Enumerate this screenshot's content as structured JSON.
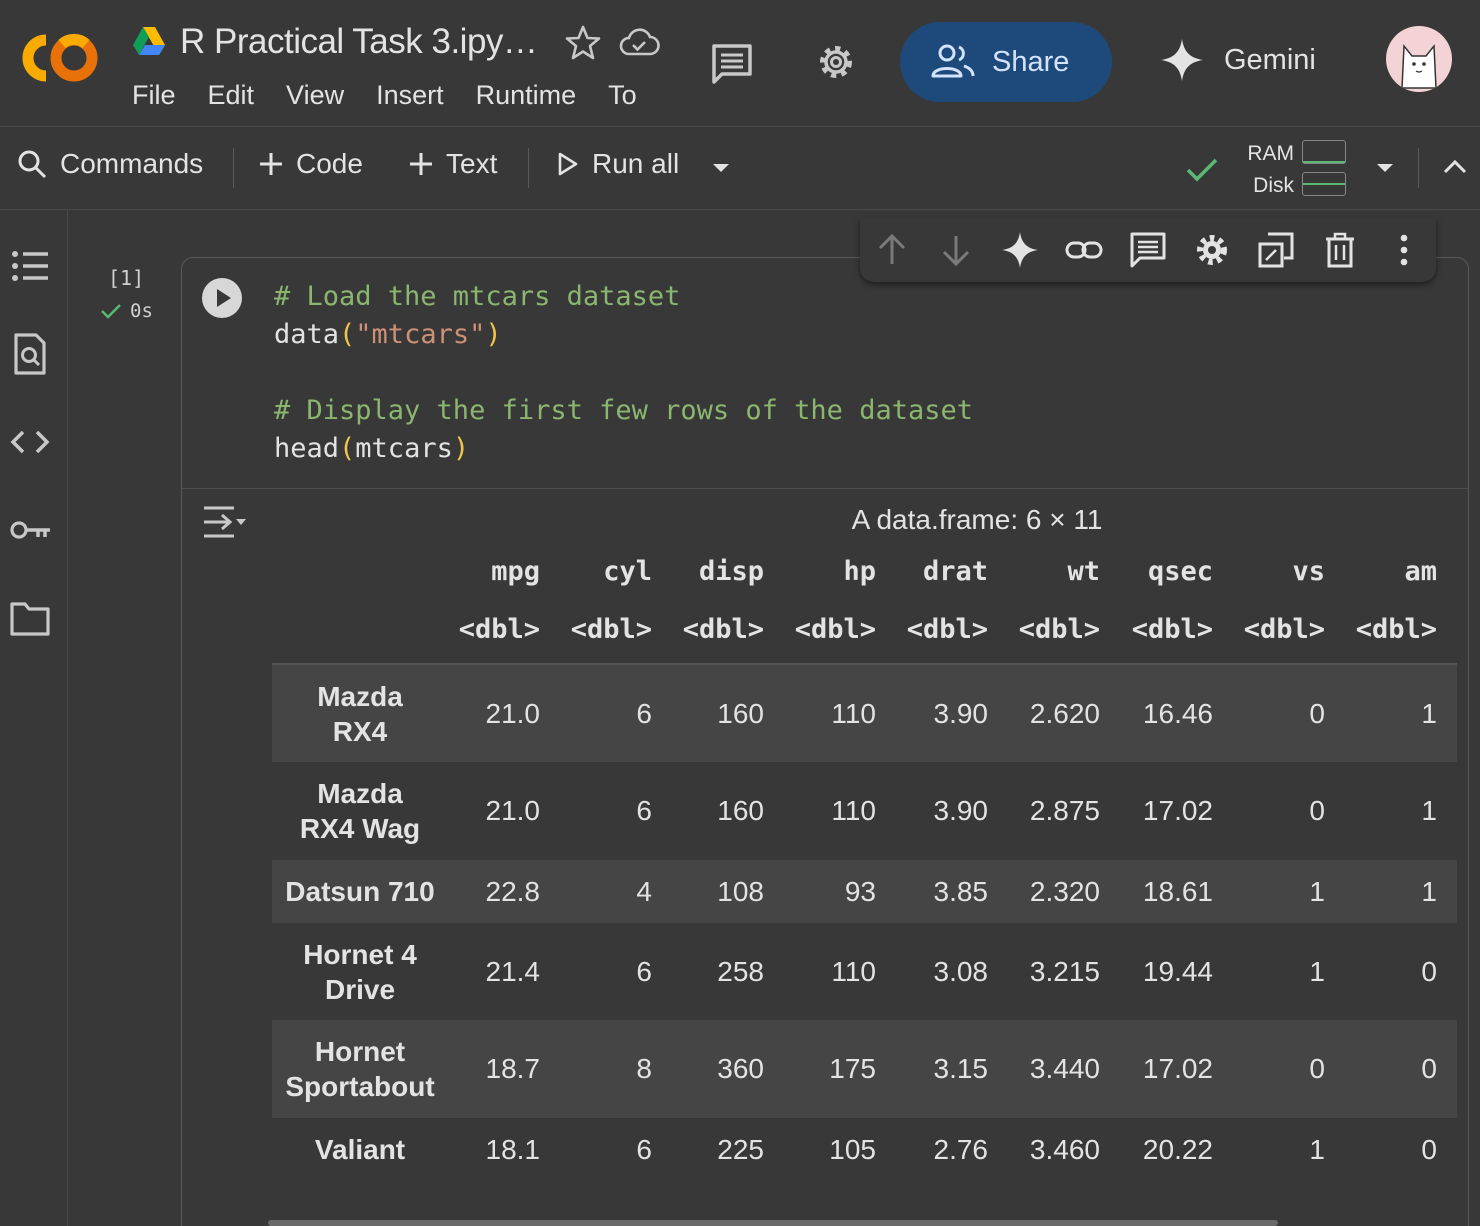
{
  "app": {
    "notebook_title": "R Practical Task 3.ipy…",
    "menu": [
      "File",
      "Edit",
      "View",
      "Insert",
      "Runtime",
      "To"
    ],
    "share_label": "Share",
    "gemini_label": "Gemini"
  },
  "toolbar": {
    "commands_label": "Commands",
    "code_label": "Code",
    "text_label": "Text",
    "run_all_label": "Run all",
    "ram_label": "RAM",
    "disk_label": "Disk",
    "status_color": "#5bb974"
  },
  "cell": {
    "exec_count": "[1]",
    "exec_time": "0s",
    "code_lines": {
      "l1": "# Load the mtcars dataset",
      "l2_fn": "data",
      "l2_arg": "\"mtcars\"",
      "l4": "# Display the first few rows of the dataset",
      "l5_fn": "head",
      "l5_arg": "mtcars"
    }
  },
  "output": {
    "caption": "A data.frame: 6 × 11",
    "columns": [
      "mpg",
      "cyl",
      "disp",
      "hp",
      "drat",
      "wt",
      "qsec",
      "vs",
      "am"
    ],
    "types": [
      "<dbl>",
      "<dbl>",
      "<dbl>",
      "<dbl>",
      "<dbl>",
      "<dbl>",
      "<dbl>",
      "<dbl>",
      "<dbl>"
    ],
    "rows": [
      {
        "name_1": "Mazda",
        "name_2": "RX4",
        "values": [
          "21.0",
          "6",
          "160",
          "110",
          "3.90",
          "2.620",
          "16.46",
          "0",
          "1"
        ]
      },
      {
        "name_1": "Mazda",
        "name_2": "RX4 Wag",
        "values": [
          "21.0",
          "6",
          "160",
          "110",
          "3.90",
          "2.875",
          "17.02",
          "0",
          "1"
        ]
      },
      {
        "name_1": "Datsun 710",
        "name_2": "",
        "values": [
          "22.8",
          "4",
          "108",
          "93",
          "3.85",
          "2.320",
          "18.61",
          "1",
          "1"
        ]
      },
      {
        "name_1": "Hornet 4",
        "name_2": "Drive",
        "values": [
          "21.4",
          "6",
          "258",
          "110",
          "3.08",
          "3.215",
          "19.44",
          "1",
          "0"
        ]
      },
      {
        "name_1": "Hornet",
        "name_2": "Sportabout",
        "values": [
          "18.7",
          "8",
          "360",
          "175",
          "3.15",
          "3.440",
          "17.02",
          "0",
          "0"
        ]
      },
      {
        "name_1": "Valiant",
        "name_2": "",
        "values": [
          "18.1",
          "6",
          "225",
          "105",
          "2.76",
          "3.460",
          "20.22",
          "1",
          "0"
        ]
      }
    ]
  },
  "icons": {
    "header": [
      "colab-logo-icon",
      "drive-icon",
      "star-icon",
      "cloud-icon",
      "comment-icon",
      "gear-icon",
      "people-icon",
      "gemini-sparkle-icon",
      "avatar"
    ],
    "sidebar": [
      "toc-icon",
      "find-icon",
      "code-snippets-icon",
      "key-icon",
      "folder-icon"
    ],
    "cell_toolbar": [
      "arrow-up-icon",
      "arrow-down-icon",
      "gemini-sparkle-icon",
      "link-icon",
      "comment-icon",
      "gear-icon",
      "mirror-cell-icon",
      "trash-icon",
      "more-vert-icon"
    ]
  }
}
